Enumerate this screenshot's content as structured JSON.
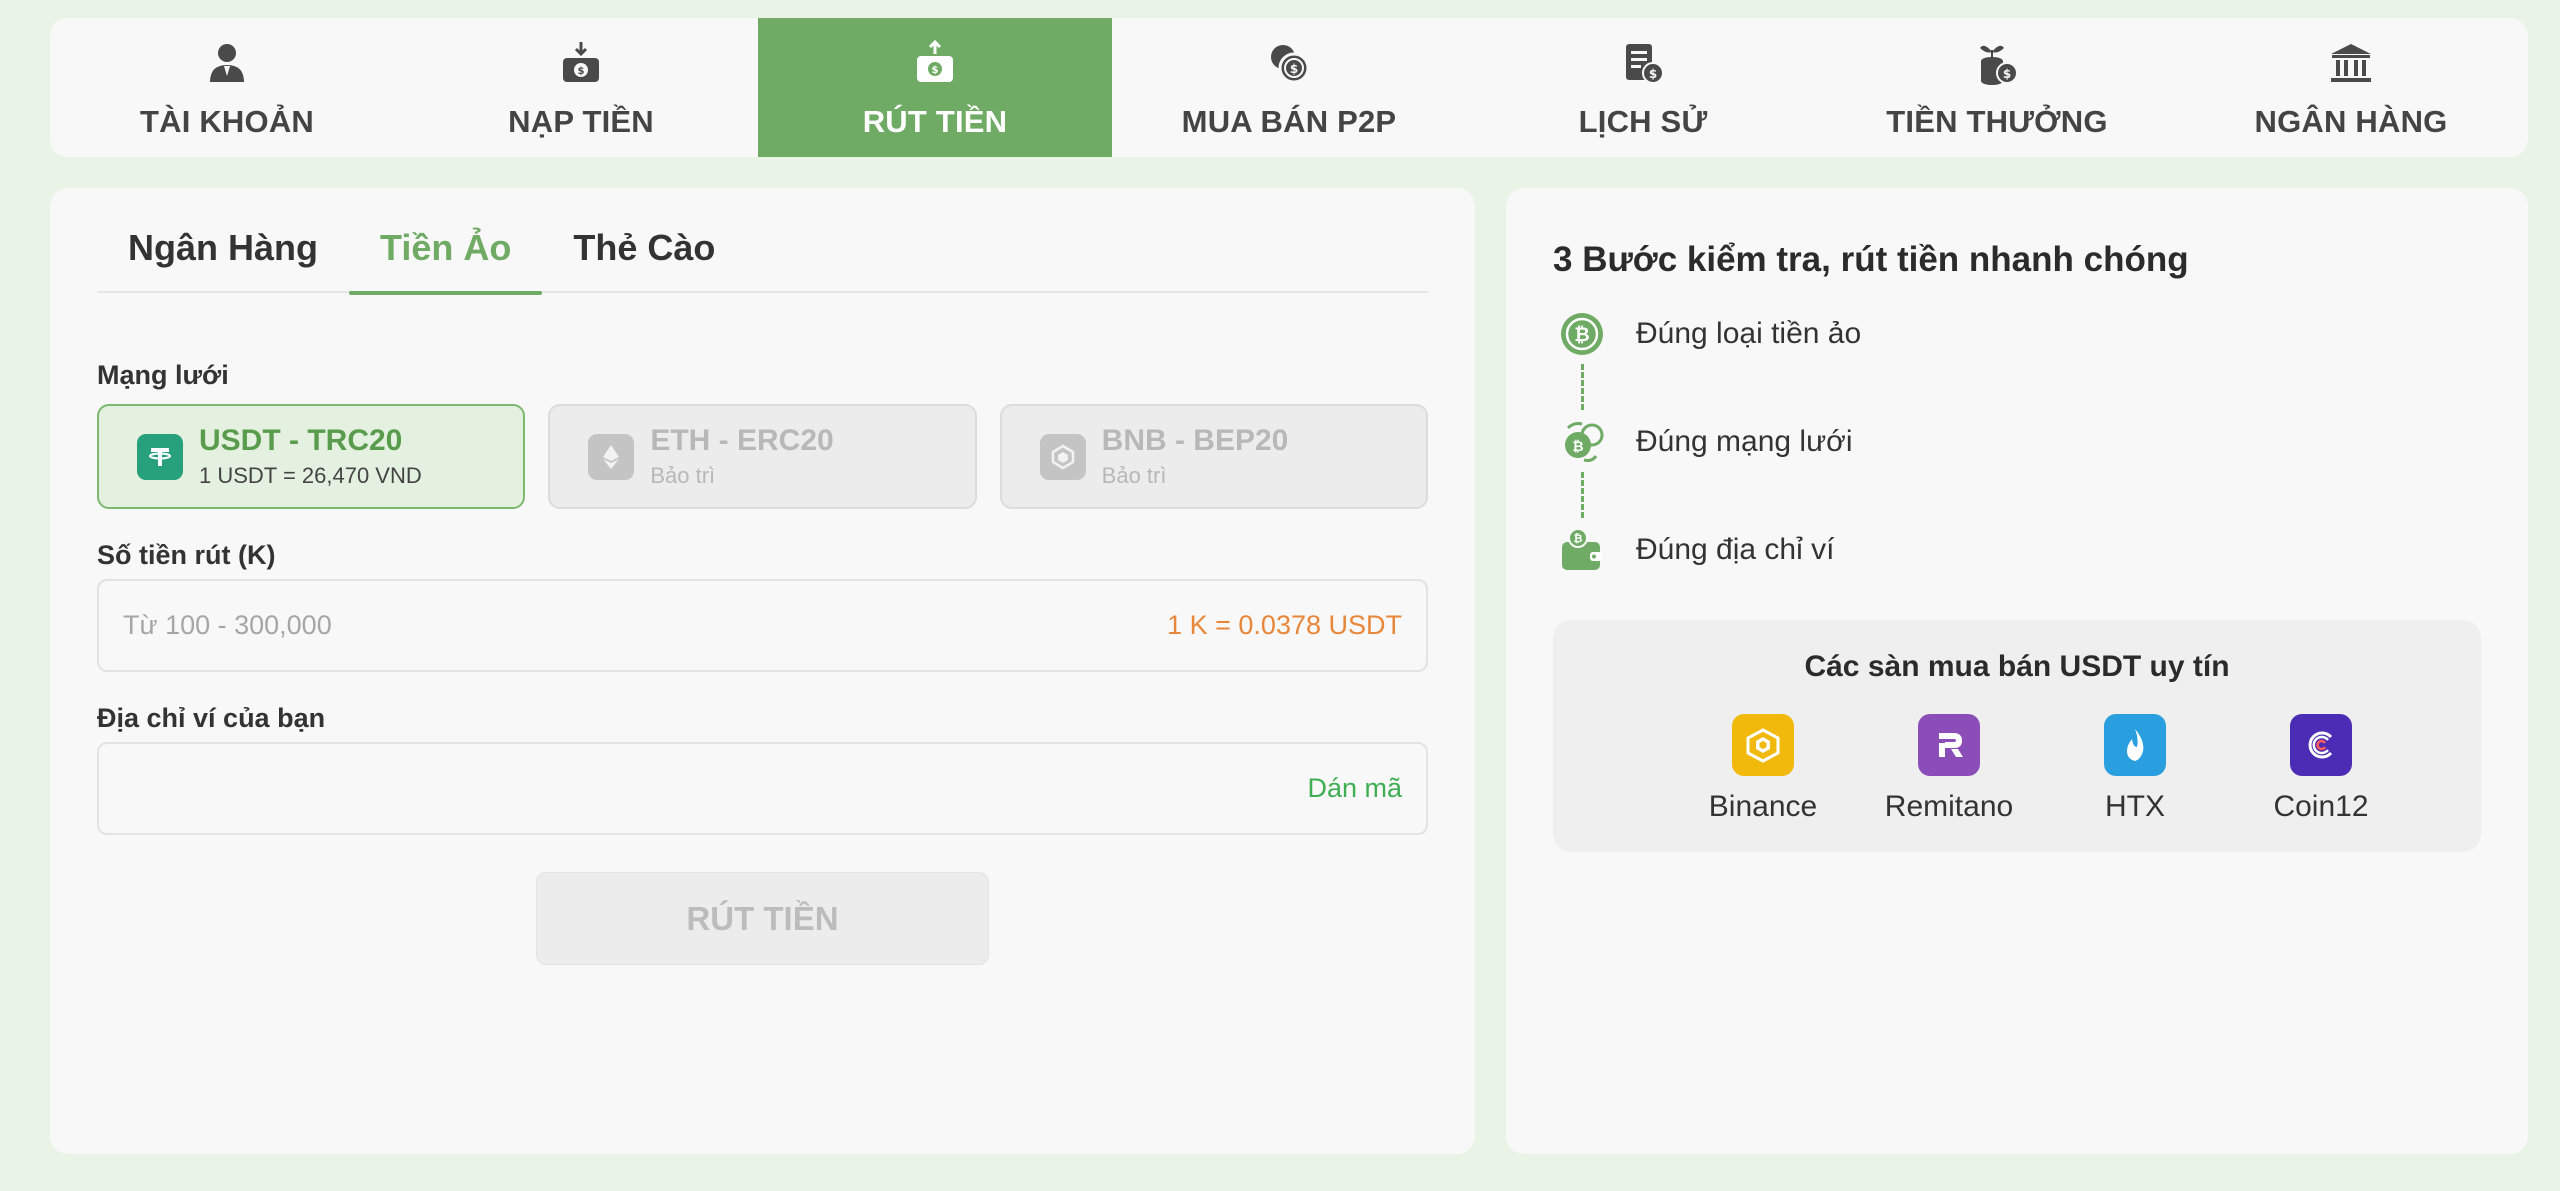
{
  "nav": {
    "items": [
      {
        "label": "TÀI KHOẢN",
        "icon": "account-icon"
      },
      {
        "label": "NẠP TIỀN",
        "icon": "deposit-icon"
      },
      {
        "label": "RÚT TIỀN",
        "icon": "withdraw-icon",
        "active": true
      },
      {
        "label": "MUA BÁN P2P",
        "icon": "p2p-coins-icon"
      },
      {
        "label": "LỊCH SỬ",
        "icon": "history-icon"
      },
      {
        "label": "TIỀN THƯỞNG",
        "icon": "bonus-icon"
      },
      {
        "label": "NGÂN HÀNG",
        "icon": "bank-icon"
      }
    ]
  },
  "withdraw": {
    "tabs": [
      {
        "label": "Ngân Hàng"
      },
      {
        "label": "Tiền Ảo",
        "active": true
      },
      {
        "label": "Thẻ Cào"
      }
    ],
    "network_label": "Mạng lưới",
    "networks": [
      {
        "name": "USDT - TRC20",
        "sub": "1 USDT = 26,470 VND",
        "selected": true,
        "icon": "tether-icon"
      },
      {
        "name": "ETH - ERC20",
        "sub": "Bảo trì",
        "selected": false,
        "icon": "ethereum-icon"
      },
      {
        "name": "BNB - BEP20",
        "sub": "Bảo trì",
        "selected": false,
        "icon": "bnb-icon"
      }
    ],
    "amount_label": "Số tiền rút (K)",
    "amount_placeholder": "Từ 100 - 300,000",
    "amount_rate": "1 K = 0.0378 USDT",
    "wallet_label": "Địa chỉ ví của bạn",
    "wallet_placeholder": "",
    "paste_label": "Dán mã",
    "submit_label": "RÚT TIỀN"
  },
  "guide": {
    "title": "3 Bước kiểm tra, rút tiền nhanh chóng",
    "steps": [
      {
        "label": "Đúng loại tiền ảo",
        "icon": "bitcoin-icon"
      },
      {
        "label": "Đúng mạng lưới",
        "icon": "network-exchange-icon"
      },
      {
        "label": "Đúng địa chỉ ví",
        "icon": "wallet-icon"
      }
    ],
    "exchanges_title": "Các sàn mua bán USDT uy tín",
    "exchanges": [
      {
        "name": "Binance",
        "color": "#f0b90b",
        "icon": "binance-icon"
      },
      {
        "name": "Remitano",
        "color": "#8b4db8",
        "icon": "remitano-icon"
      },
      {
        "name": "HTX",
        "color": "#2a9fe0",
        "icon": "htx-icon"
      },
      {
        "name": "Coin12",
        "color": "#4b2db5",
        "icon": "coin12-icon"
      }
    ]
  },
  "colors": {
    "accent": "#6fab64",
    "background": "#eaf4e6",
    "rate": "#e8873a",
    "paste": "#3fae54"
  }
}
